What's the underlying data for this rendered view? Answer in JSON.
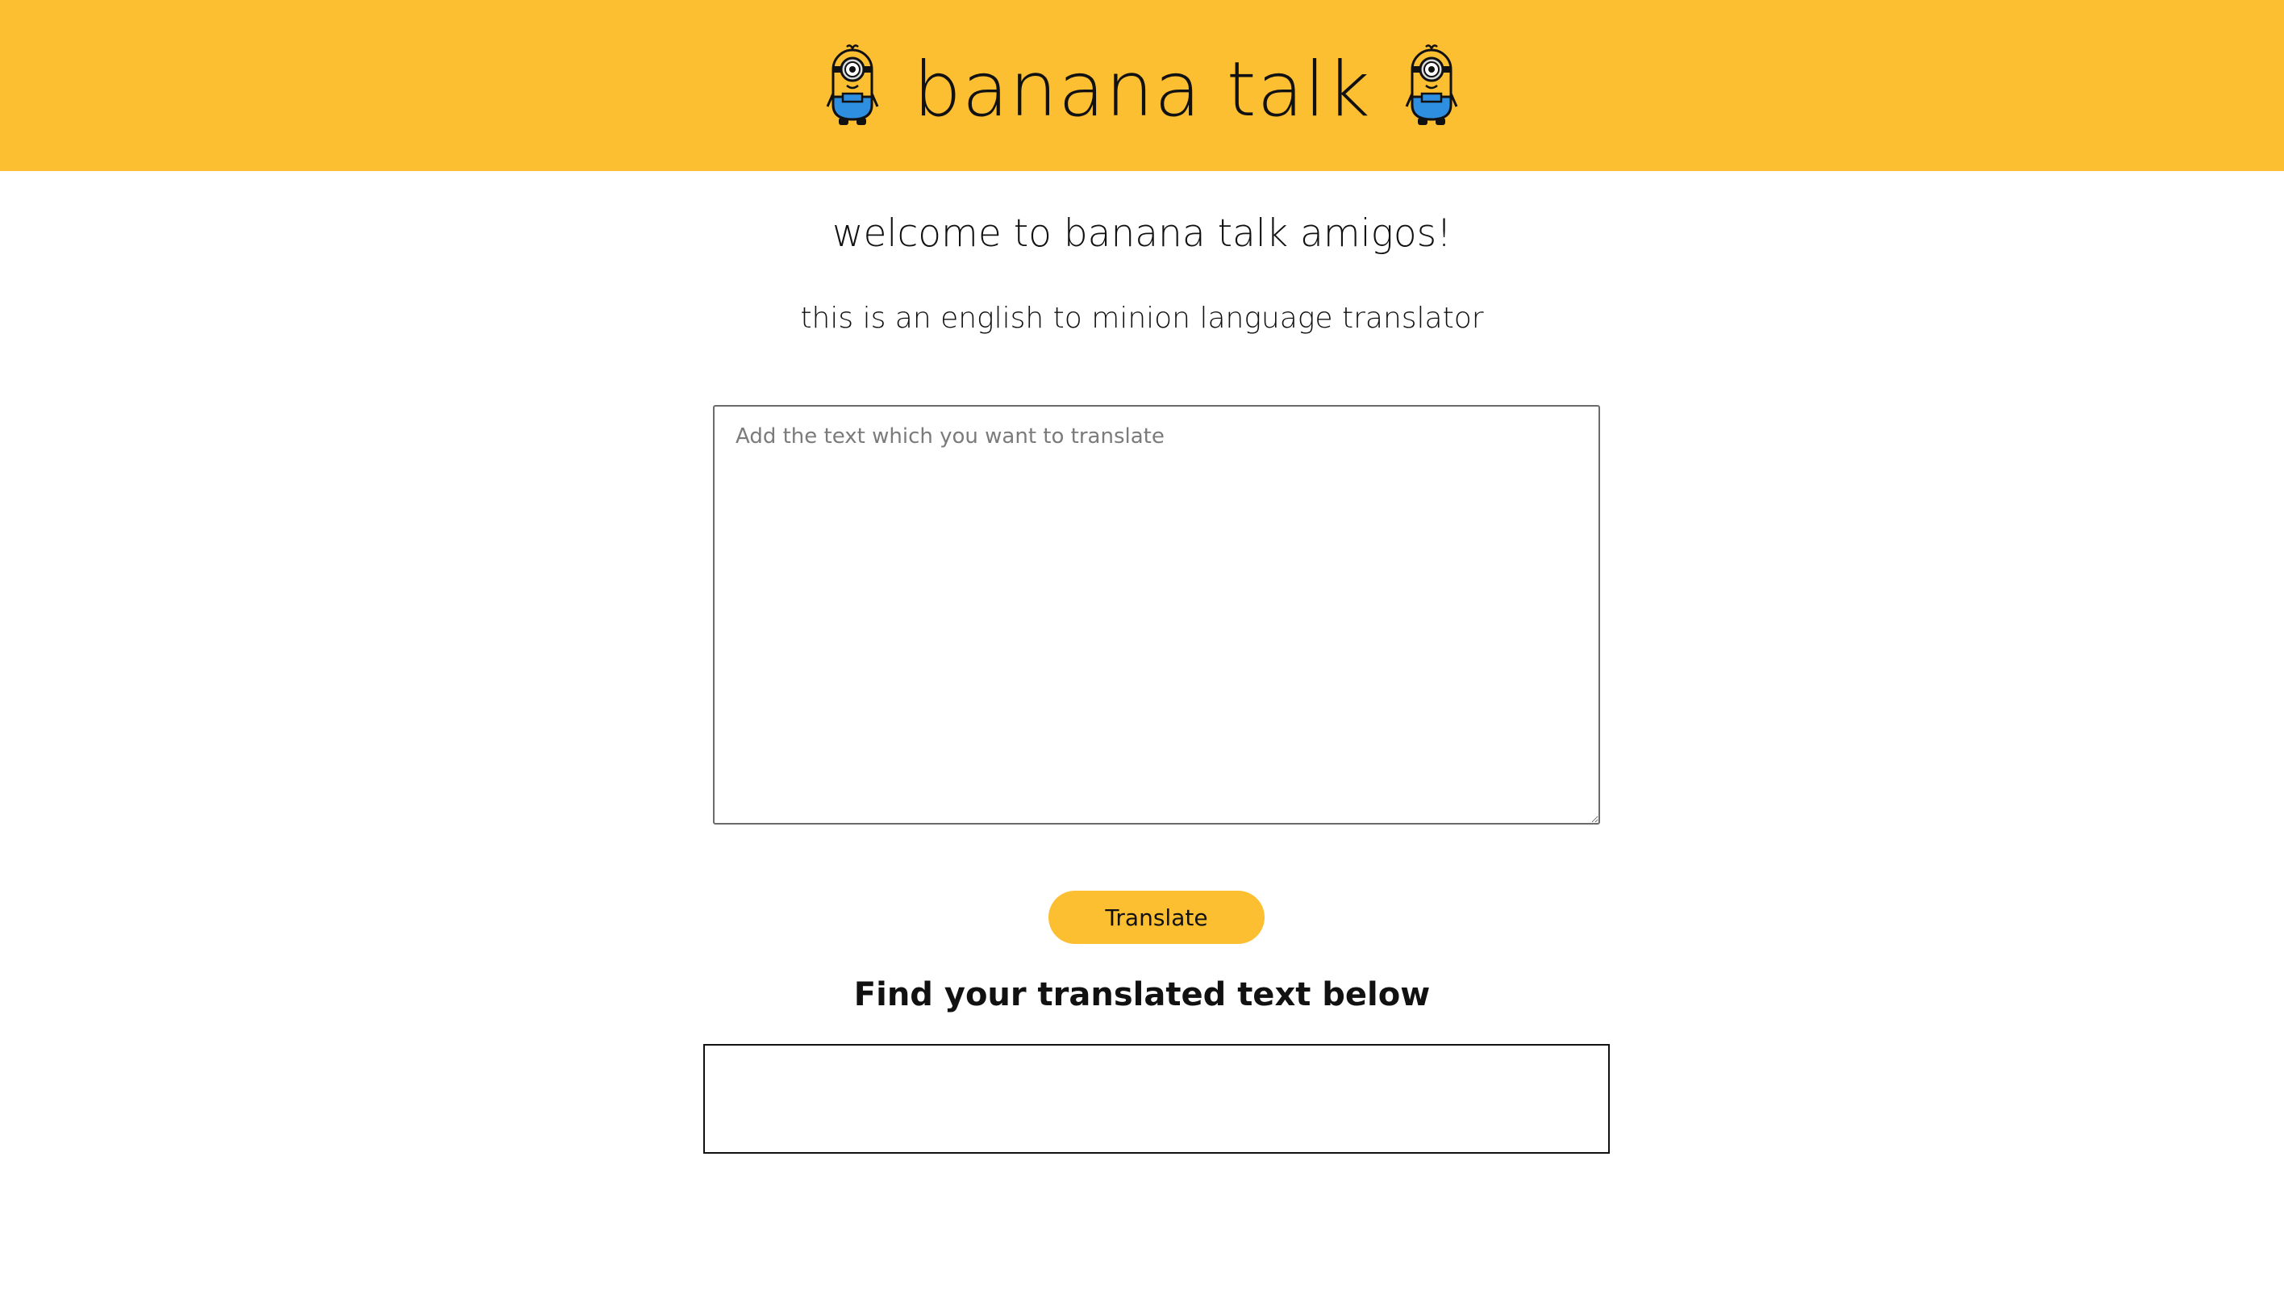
{
  "header": {
    "title": "banana talk",
    "left_icon": "minion-icon",
    "right_icon": "minion-icon",
    "background_color": "#FDBF32"
  },
  "main": {
    "welcome_heading": "welcome to banana talk amigos!",
    "subtitle": "this is an english to minion language translator",
    "input": {
      "placeholder": "Add the text which you want to translate",
      "value": ""
    },
    "translate_button_label": "Translate",
    "output_label": "Find your translated text below",
    "output_value": ""
  },
  "colors": {
    "accent": "#FDBF32",
    "text": "#111111",
    "minion_blue": "#2E8FE0"
  }
}
